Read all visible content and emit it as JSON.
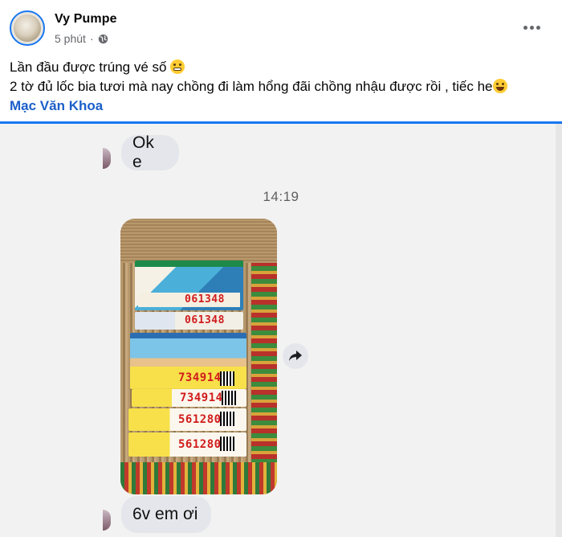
{
  "post": {
    "author": "Vy Pumpe",
    "time": "5 phút",
    "separator": "·",
    "line1": "Lần đầu được trúng vé số",
    "line2": "2 tờ đủ lốc bia tươi mà nay chồng đi làm hổng đãi chồng nhậu được rồi , tiếc he",
    "mention": "Mạc Văn Khoa"
  },
  "chat": {
    "msg1": "Ok e",
    "timestamp": "14:19",
    "msg2": "6v em ơi",
    "tickets": [
      {
        "number": "061348"
      },
      {
        "number": "061348"
      },
      {
        "number": "734914"
      },
      {
        "number": "734914"
      },
      {
        "number": "561280"
      },
      {
        "number": "561280"
      }
    ]
  },
  "colors": {
    "accent": "#1877f2",
    "mention": "#1c5fc9",
    "bubble": "#e4e6eb"
  }
}
